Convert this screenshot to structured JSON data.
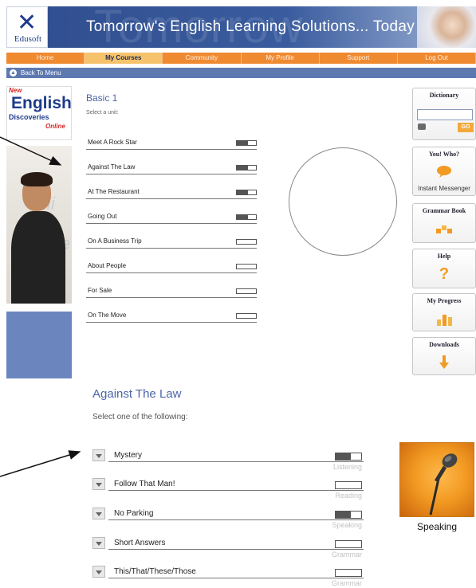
{
  "header": {
    "logo_text": "Edusoft",
    "title": "Tomorrow's English Learning Solutions... Today",
    "watermark": "Tomorrow"
  },
  "nav": {
    "items": [
      "Home",
      "My Courses",
      "Community",
      "My Profile",
      "Support",
      "Log Out"
    ],
    "active": "My Courses"
  },
  "back": {
    "label": "Back To Menu"
  },
  "brand": {
    "new": "New",
    "english": "English",
    "discoveries": "Discoveries",
    "online": "Online"
  },
  "course": {
    "title": "Basic 1",
    "instruction": "Select a unit:",
    "units": [
      {
        "name": "Meet A Rock Star",
        "progress": 0.6
      },
      {
        "name": "Against The Law",
        "progress": 0.6
      },
      {
        "name": "At The Restaurant",
        "progress": 0.6
      },
      {
        "name": "Going Out",
        "progress": 0.6
      },
      {
        "name": "On A Business Trip",
        "progress": 0
      },
      {
        "name": "About People",
        "progress": 0
      },
      {
        "name": "For Sale",
        "progress": 0
      },
      {
        "name": "On The Move",
        "progress": 0
      }
    ]
  },
  "widgets": {
    "dictionary": {
      "title": "Dictionary",
      "input_value": "",
      "go_label": "GO"
    },
    "youwho": {
      "title": "You! Who?",
      "label": "Instant Messenger"
    },
    "grammar": {
      "title": "Grammar Book"
    },
    "help": {
      "title": "Help"
    },
    "progress": {
      "title": "My Progress"
    },
    "downloads": {
      "title": "Downloads"
    }
  },
  "unit_detail": {
    "title": "Against The Law",
    "instruction": "Select one of the following:",
    "activities": [
      {
        "name": "Mystery",
        "skill": "Listening",
        "progress": 0.6
      },
      {
        "name": "Follow That Man!",
        "skill": "Reading",
        "progress": 0
      },
      {
        "name": "No Parking",
        "skill": "Speaking",
        "progress": 0.6
      },
      {
        "name": "Short Answers",
        "skill": "Grammar",
        "progress": 0
      },
      {
        "name": "This/That/These/Those",
        "skill": "Grammar",
        "progress": 0
      }
    ]
  },
  "speaking_panel": {
    "label": "Speaking"
  },
  "colors": {
    "accent_orange": "#f08a30",
    "nav_blue": "#5d79b0",
    "title_blue": "#4a66a8",
    "header_blue": "#2f4d8e"
  }
}
